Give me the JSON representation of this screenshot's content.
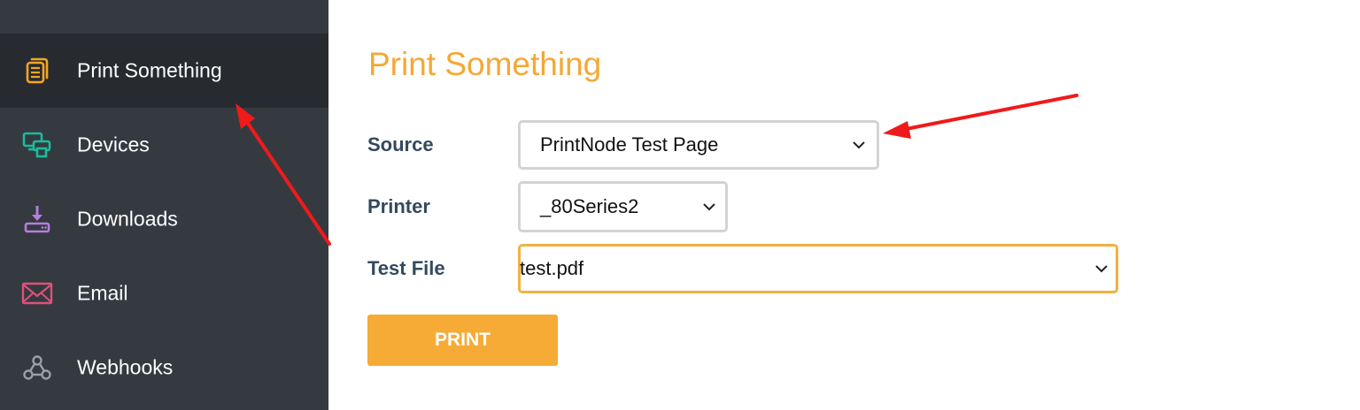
{
  "sidebar": {
    "items": [
      {
        "label": "Print Something",
        "icon": "documents-icon",
        "color": "#f5a623"
      },
      {
        "label": "Devices",
        "icon": "devices-icon",
        "color": "#1abc9c"
      },
      {
        "label": "Downloads",
        "icon": "download-icon",
        "color": "#b47fe0"
      },
      {
        "label": "Email",
        "icon": "envelope-icon",
        "color": "#e0507a"
      },
      {
        "label": "Webhooks",
        "icon": "webhook-icon",
        "color": "#9aa0a6"
      }
    ]
  },
  "main": {
    "title": "Print Something",
    "form": {
      "source": {
        "label": "Source",
        "value": "PrintNode Test Page"
      },
      "printer": {
        "label": "Printer",
        "value": "_80Series2"
      },
      "test_file": {
        "label": "Test File",
        "value": "test.pdf"
      },
      "print_button": "PRINT"
    }
  },
  "colors": {
    "accent": "#f5a835",
    "sidebar_bg": "#343a40",
    "sidebar_active_bg": "#272b30",
    "annotation_arrow": "#f01a1a"
  }
}
